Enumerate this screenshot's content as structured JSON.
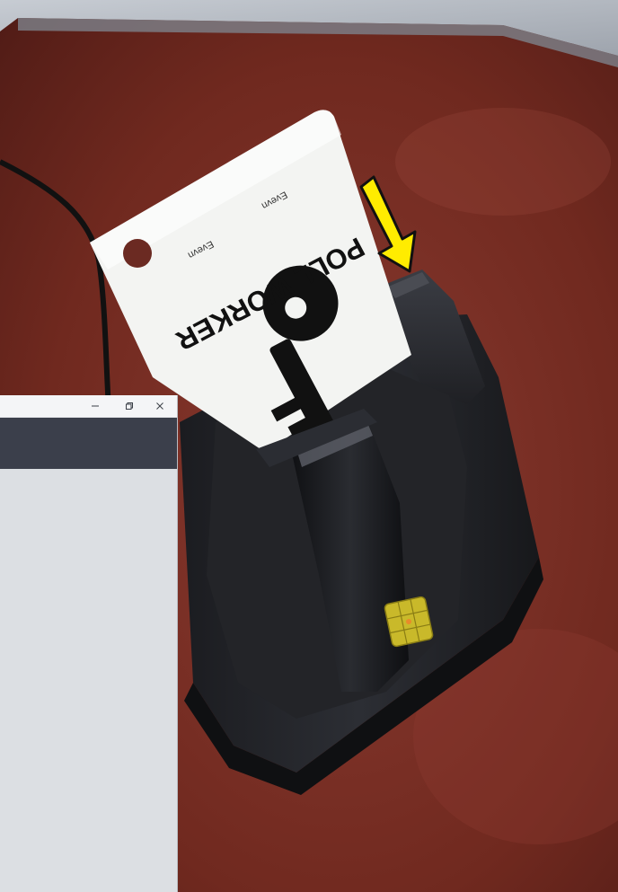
{
  "photo": {
    "card": {
      "title": "POLL WORKER",
      "small_caption_a": "Evevn",
      "small_caption_b": "Evevn",
      "icon": "key-icon"
    },
    "arrow_color": "#ffec00",
    "chip_color": "#c9b92a",
    "reader_icon": "smart-card-reader"
  },
  "window": {
    "controls": {
      "minimize_icon": "minimize-icon",
      "restore_icon": "restore-icon",
      "close_icon": "close-icon"
    },
    "header_color": "#3b3f4b",
    "body_color": "#dcdfe3"
  }
}
